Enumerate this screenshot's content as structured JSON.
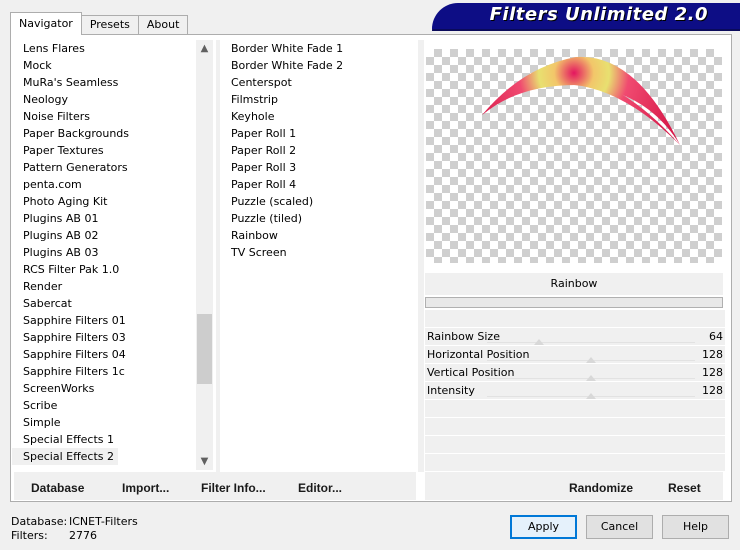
{
  "tabs": [
    {
      "label": "Navigator",
      "active": true
    },
    {
      "label": "Presets",
      "active": false
    },
    {
      "label": "About",
      "active": false
    }
  ],
  "banner": {
    "title": "Filters Unlimited 2.0"
  },
  "categories": [
    "Lens Flares",
    "Mock",
    "MuRa's Seamless",
    "Neology",
    "Noise Filters",
    "Paper Backgrounds",
    "Paper Textures",
    "Pattern Generators",
    "penta.com",
    "Photo Aging Kit",
    "Plugins AB 01",
    "Plugins AB 02",
    "Plugins AB 03",
    "RCS Filter Pak 1.0",
    "Render",
    "Sabercat",
    "Sapphire Filters 01",
    "Sapphire Filters 03",
    "Sapphire Filters 04",
    "Sapphire Filters 1c",
    "ScreenWorks",
    "Scribe",
    "Simple",
    "Special Effects 1",
    "Special Effects 2"
  ],
  "selected_category": "Special Effects 2",
  "filters": [
    "Border White Fade 1",
    "Border White Fade 2",
    "Centerspot",
    "Filmstrip",
    "Keyhole",
    "Paper Roll 1",
    "Paper Roll 2",
    "Paper Roll 3",
    "Paper Roll 4",
    "Puzzle (scaled)",
    "Puzzle (tiled)",
    "Rainbow",
    "TV Screen"
  ],
  "selected_filter": "Rainbow",
  "filter_panel": {
    "title": "Rainbow"
  },
  "params": [
    {
      "label": "Rainbow Size",
      "value": "64",
      "level": 0.25
    },
    {
      "label": "Horizontal Position",
      "value": "128",
      "level": 0.5
    },
    {
      "label": "Vertical Position",
      "value": "128",
      "level": 0.5
    },
    {
      "label": "Intensity",
      "value": "128",
      "level": 0.5
    }
  ],
  "left_buttons": {
    "database": "Database",
    "import": "Import...",
    "filter_info": "Filter Info...",
    "editor": "Editor..."
  },
  "right_buttons": {
    "randomize": "Randomize",
    "reset": "Reset"
  },
  "status": {
    "database_label": "Database:",
    "database_value": "ICNET-Filters",
    "filters_label": "Filters:",
    "filters_value": "2776"
  },
  "dialog_buttons": {
    "apply": "Apply",
    "cancel": "Cancel",
    "help": "Help"
  },
  "colors": {
    "banner_bg": "#0d0d85",
    "preview_rainbow": "#e0204f",
    "preview_highlight": "#f0e060"
  }
}
